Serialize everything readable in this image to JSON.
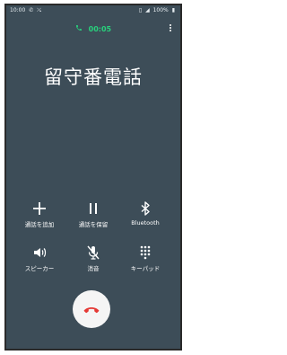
{
  "status_bar": {
    "time": "10:00",
    "left_icons": [
      "phone-icon",
      "missed-call-icon"
    ],
    "right_icons": [
      "vibrate-icon",
      "signal-icon"
    ],
    "battery_percent": "100%"
  },
  "call": {
    "timer": "00:05",
    "title": "留守番電話"
  },
  "controls": {
    "row1": [
      {
        "label": "通話を追加",
        "icon": "plus-icon"
      },
      {
        "label": "通話を保留",
        "icon": "pause-icon"
      },
      {
        "label": "Bluetooth",
        "icon": "bluetooth-icon"
      }
    ],
    "row2": [
      {
        "label": "スピーカー",
        "icon": "speaker-icon"
      },
      {
        "label": "消音",
        "icon": "mute-mic-icon"
      },
      {
        "label": "キーパッド",
        "icon": "keypad-icon"
      }
    ]
  },
  "colors": {
    "background": "#3d4d58",
    "timer_green": "#28d17c",
    "end_call_red": "#e53935",
    "end_call_button": "#f5f5f5"
  }
}
